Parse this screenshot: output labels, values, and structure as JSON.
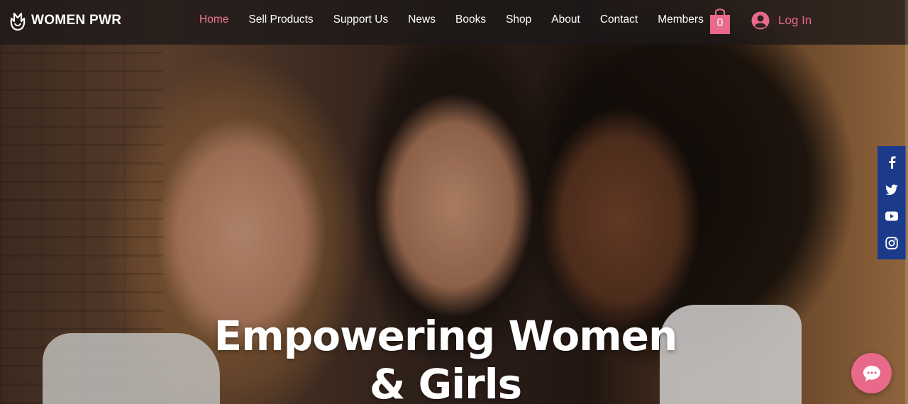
{
  "brand": {
    "name": "WOMEN PWR",
    "icon": "tulip-logo-icon"
  },
  "nav": {
    "items": [
      {
        "label": "Home",
        "active": true
      },
      {
        "label": "Sell Products",
        "active": false
      },
      {
        "label": "Support Us",
        "active": false
      },
      {
        "label": "News",
        "active": false
      },
      {
        "label": "Books",
        "active": false
      },
      {
        "label": "Shop",
        "active": false
      },
      {
        "label": "About",
        "active": false
      },
      {
        "label": "Contact",
        "active": false
      },
      {
        "label": "Members",
        "active": false
      }
    ]
  },
  "cart": {
    "count": "0",
    "icon": "shopping-bag-icon",
    "color": "#e8698a"
  },
  "account": {
    "login_label": "Log In",
    "icon": "user-avatar-icon",
    "color": "#e8698a"
  },
  "social": {
    "background": "#1b3a8a",
    "items": [
      {
        "name": "facebook",
        "icon": "facebook-icon"
      },
      {
        "name": "twitter",
        "icon": "twitter-icon"
      },
      {
        "name": "youtube",
        "icon": "youtube-icon"
      },
      {
        "name": "instagram",
        "icon": "instagram-icon"
      }
    ]
  },
  "hero": {
    "headline_line1": "Empowering Women",
    "headline_line2": "& Girls",
    "image": "three-smiling-women-photo"
  },
  "chat": {
    "icon": "chat-bubble-icon",
    "color": "#e8698a"
  },
  "colors": {
    "accent": "#f07a94",
    "header_bg": "#1c1818"
  }
}
